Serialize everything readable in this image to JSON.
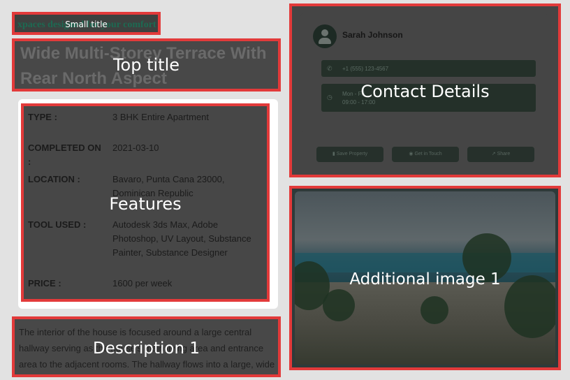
{
  "annotations": {
    "small_title": "Small title",
    "top_title": "Top title",
    "features": "Features",
    "description": "Description 1",
    "contact": "Contact Details",
    "image": "Additional image 1"
  },
  "page": {
    "small_title": "xpaces designed for your comfort",
    "top_title": "Wide Multi-Storey Terrace With Rear North Aspect",
    "features": [
      {
        "key": "TYPE :",
        "value": "3 BHK Entire Apartment"
      },
      {
        "key": "COMPLETED ON :",
        "value": "2021-03-10"
      },
      {
        "key": "LOCATION :",
        "value": "Bavaro, Punta Cana 23000, Dominican Republic"
      },
      {
        "key": "TOOL USED :",
        "value": "Autodesk 3ds Max, Adobe Photoshop, UV Layout, Substance Painter, Substance Designer"
      },
      {
        "key": "PRICE :",
        "value": "1600   per week"
      }
    ],
    "description": "The interior of the house is focused around a large central hallway serving as the house's main living area and entrance area to the adjacent rooms. The hallway flows into a large, wide staircase that provides the main means of egress."
  },
  "contact": {
    "name": "Sarah Johnson",
    "phone": "+1 (555) 123-4567",
    "hours_label": "Mon - Fri",
    "hours": "09:00 - 17:00",
    "actions": [
      "Save Property",
      "Get in Touch",
      "Share"
    ]
  },
  "icons": {
    "phone": "phone-icon",
    "clock": "clock-icon",
    "bookmark": "bookmark-icon",
    "chat": "chat-icon",
    "share": "share-icon",
    "avatar": "user-icon"
  },
  "colors": {
    "annotation_border": "#e23a3a",
    "overlay": "#373737",
    "accent_green": "#1d6a52"
  }
}
